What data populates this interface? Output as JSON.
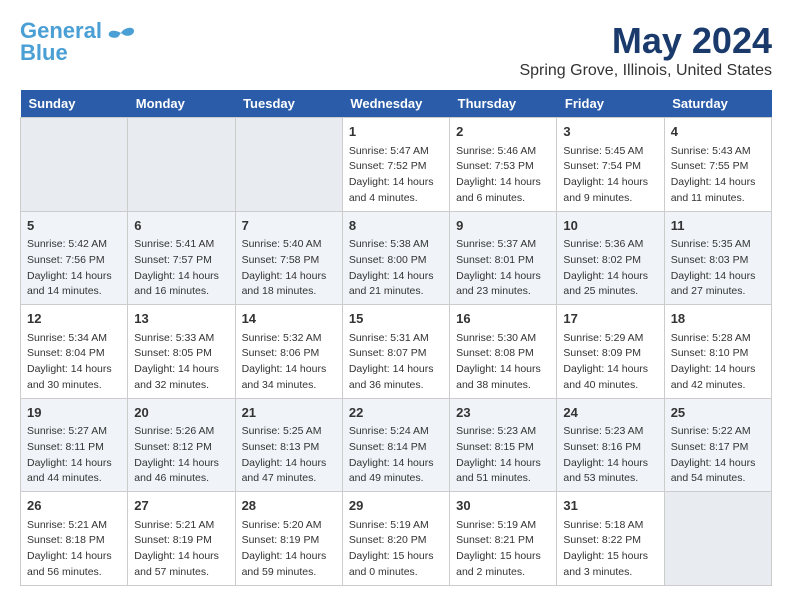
{
  "logo": {
    "line1": "General",
    "line2": "Blue"
  },
  "title": "May 2024",
  "subtitle": "Spring Grove, Illinois, United States",
  "days_of_week": [
    "Sunday",
    "Monday",
    "Tuesday",
    "Wednesday",
    "Thursday",
    "Friday",
    "Saturday"
  ],
  "weeks": [
    [
      {
        "day": "",
        "info": ""
      },
      {
        "day": "",
        "info": ""
      },
      {
        "day": "",
        "info": ""
      },
      {
        "day": "1",
        "info": "Sunrise: 5:47 AM\nSunset: 7:52 PM\nDaylight: 14 hours\nand 4 minutes."
      },
      {
        "day": "2",
        "info": "Sunrise: 5:46 AM\nSunset: 7:53 PM\nDaylight: 14 hours\nand 6 minutes."
      },
      {
        "day": "3",
        "info": "Sunrise: 5:45 AM\nSunset: 7:54 PM\nDaylight: 14 hours\nand 9 minutes."
      },
      {
        "day": "4",
        "info": "Sunrise: 5:43 AM\nSunset: 7:55 PM\nDaylight: 14 hours\nand 11 minutes."
      }
    ],
    [
      {
        "day": "5",
        "info": "Sunrise: 5:42 AM\nSunset: 7:56 PM\nDaylight: 14 hours\nand 14 minutes."
      },
      {
        "day": "6",
        "info": "Sunrise: 5:41 AM\nSunset: 7:57 PM\nDaylight: 14 hours\nand 16 minutes."
      },
      {
        "day": "7",
        "info": "Sunrise: 5:40 AM\nSunset: 7:58 PM\nDaylight: 14 hours\nand 18 minutes."
      },
      {
        "day": "8",
        "info": "Sunrise: 5:38 AM\nSunset: 8:00 PM\nDaylight: 14 hours\nand 21 minutes."
      },
      {
        "day": "9",
        "info": "Sunrise: 5:37 AM\nSunset: 8:01 PM\nDaylight: 14 hours\nand 23 minutes."
      },
      {
        "day": "10",
        "info": "Sunrise: 5:36 AM\nSunset: 8:02 PM\nDaylight: 14 hours\nand 25 minutes."
      },
      {
        "day": "11",
        "info": "Sunrise: 5:35 AM\nSunset: 8:03 PM\nDaylight: 14 hours\nand 27 minutes."
      }
    ],
    [
      {
        "day": "12",
        "info": "Sunrise: 5:34 AM\nSunset: 8:04 PM\nDaylight: 14 hours\nand 30 minutes."
      },
      {
        "day": "13",
        "info": "Sunrise: 5:33 AM\nSunset: 8:05 PM\nDaylight: 14 hours\nand 32 minutes."
      },
      {
        "day": "14",
        "info": "Sunrise: 5:32 AM\nSunset: 8:06 PM\nDaylight: 14 hours\nand 34 minutes."
      },
      {
        "day": "15",
        "info": "Sunrise: 5:31 AM\nSunset: 8:07 PM\nDaylight: 14 hours\nand 36 minutes."
      },
      {
        "day": "16",
        "info": "Sunrise: 5:30 AM\nSunset: 8:08 PM\nDaylight: 14 hours\nand 38 minutes."
      },
      {
        "day": "17",
        "info": "Sunrise: 5:29 AM\nSunset: 8:09 PM\nDaylight: 14 hours\nand 40 minutes."
      },
      {
        "day": "18",
        "info": "Sunrise: 5:28 AM\nSunset: 8:10 PM\nDaylight: 14 hours\nand 42 minutes."
      }
    ],
    [
      {
        "day": "19",
        "info": "Sunrise: 5:27 AM\nSunset: 8:11 PM\nDaylight: 14 hours\nand 44 minutes."
      },
      {
        "day": "20",
        "info": "Sunrise: 5:26 AM\nSunset: 8:12 PM\nDaylight: 14 hours\nand 46 minutes."
      },
      {
        "day": "21",
        "info": "Sunrise: 5:25 AM\nSunset: 8:13 PM\nDaylight: 14 hours\nand 47 minutes."
      },
      {
        "day": "22",
        "info": "Sunrise: 5:24 AM\nSunset: 8:14 PM\nDaylight: 14 hours\nand 49 minutes."
      },
      {
        "day": "23",
        "info": "Sunrise: 5:23 AM\nSunset: 8:15 PM\nDaylight: 14 hours\nand 51 minutes."
      },
      {
        "day": "24",
        "info": "Sunrise: 5:23 AM\nSunset: 8:16 PM\nDaylight: 14 hours\nand 53 minutes."
      },
      {
        "day": "25",
        "info": "Sunrise: 5:22 AM\nSunset: 8:17 PM\nDaylight: 14 hours\nand 54 minutes."
      }
    ],
    [
      {
        "day": "26",
        "info": "Sunrise: 5:21 AM\nSunset: 8:18 PM\nDaylight: 14 hours\nand 56 minutes."
      },
      {
        "day": "27",
        "info": "Sunrise: 5:21 AM\nSunset: 8:19 PM\nDaylight: 14 hours\nand 57 minutes."
      },
      {
        "day": "28",
        "info": "Sunrise: 5:20 AM\nSunset: 8:19 PM\nDaylight: 14 hours\nand 59 minutes."
      },
      {
        "day": "29",
        "info": "Sunrise: 5:19 AM\nSunset: 8:20 PM\nDaylight: 15 hours\nand 0 minutes."
      },
      {
        "day": "30",
        "info": "Sunrise: 5:19 AM\nSunset: 8:21 PM\nDaylight: 15 hours\nand 2 minutes."
      },
      {
        "day": "31",
        "info": "Sunrise: 5:18 AM\nSunset: 8:22 PM\nDaylight: 15 hours\nand 3 minutes."
      },
      {
        "day": "",
        "info": ""
      }
    ]
  ]
}
